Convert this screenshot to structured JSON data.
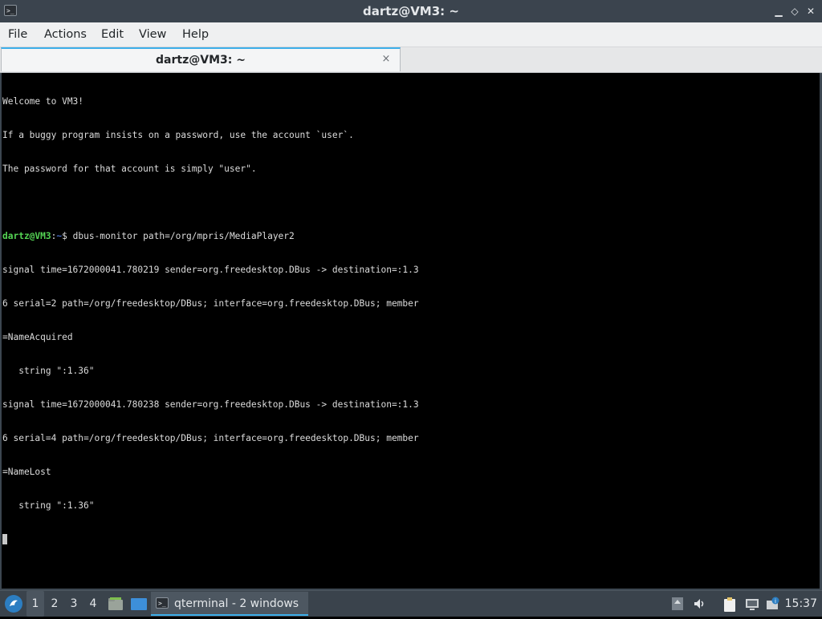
{
  "window": {
    "title": "dartz@VM3: ~",
    "minimize_glyph": "▁",
    "maximize_glyph": "◇",
    "close_glyph": "✕",
    "app_icon_glyph": ">_"
  },
  "menubar": {
    "items": [
      "File",
      "Actions",
      "Edit",
      "View",
      "Help"
    ]
  },
  "tabs": [
    {
      "label": "dartz@VM3: ~",
      "close_glyph": "×"
    }
  ],
  "terminal": {
    "lines": [
      "Welcome to VM3!",
      "If a buggy program insists on a password, use the account `user`.",
      "The password for that account is simply \"user\".",
      "",
      null,
      "signal time=1672000041.780219 sender=org.freedesktop.DBus -> destination=:1.3",
      "6 serial=2 path=/org/freedesktop/DBus; interface=org.freedesktop.DBus; member",
      "=NameAcquired",
      "   string \":1.36\"",
      "signal time=1672000041.780238 sender=org.freedesktop.DBus -> destination=:1.3",
      "6 serial=4 path=/org/freedesktop/DBus; interface=org.freedesktop.DBus; member",
      "=NameLost",
      "   string \":1.36\""
    ],
    "prompt": {
      "user_host": "dartz@VM3",
      "separator": ":",
      "path": "~",
      "symbol": "$",
      "command": " dbus-monitor path=/org/mpris/MediaPlayer2"
    }
  },
  "taskbar": {
    "desktops": [
      "1",
      "2",
      "3",
      "4"
    ],
    "active_desktop": "1",
    "task_label": "qterminal - 2 windows",
    "clock": "15:37",
    "icons": {
      "start": "start-menu-icon",
      "files": "file-manager-icon",
      "show_desktop": "show-desktop-icon",
      "tray": [
        "updates-icon",
        "volume-icon",
        "clipboard-icon",
        "network-icon",
        "notification-icon"
      ]
    },
    "accent_color": "#3daee9"
  },
  "colors": {
    "prompt_user": "#54d454",
    "prompt_path": "#5c8cff",
    "terminal_bg": "#000000",
    "terminal_fg": "#dcdcdc"
  }
}
